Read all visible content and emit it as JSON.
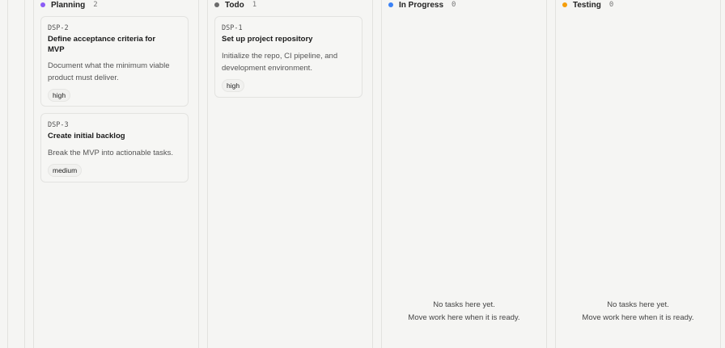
{
  "columns": [
    {
      "title": "Planning",
      "count": "2",
      "color": "#8b5cf6",
      "cards": [
        {
          "id": "DSP-2",
          "title": "Define acceptance criteria for MVP",
          "description": "Document what the minimum viable product must deliver.",
          "priority": "high"
        },
        {
          "id": "DSP-3",
          "title": "Create initial backlog",
          "description": "Break the MVP into actionable tasks.",
          "priority": "medium"
        }
      ]
    },
    {
      "title": "Todo",
      "count": "1",
      "color": "#6b6b6b",
      "cards": [
        {
          "id": "DSP-1",
          "title": "Set up project repository",
          "description": "Initialize the repo, CI pipeline, and development environment.",
          "priority": "high"
        }
      ]
    },
    {
      "title": "In Progress",
      "count": "0",
      "color": "#3b82f6",
      "empty_line1": "No tasks here yet.",
      "empty_line2": "Move work here when it is ready."
    },
    {
      "title": "Testing",
      "count": "0",
      "color": "#f59e0b",
      "empty_line1": "No tasks here yet.",
      "empty_line2": "Move work here when it is ready."
    }
  ]
}
